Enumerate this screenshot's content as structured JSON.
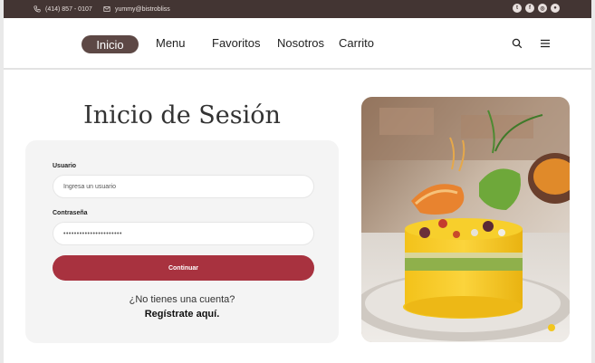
{
  "topbar": {
    "phone": "(414) 857 - 0107",
    "email": "yummy@bistrobliss",
    "social_icons": [
      "twitter-icon",
      "facebook-icon",
      "instagram-icon",
      "github-icon"
    ],
    "social_glyphs": [
      "t",
      "f",
      "◎",
      "●"
    ],
    "background": "#433533"
  },
  "nav": {
    "items": [
      "Inicio",
      "Menu",
      "Favoritos",
      "Nosotros",
      "Carrito"
    ],
    "active_index": 0,
    "active_color": "#5d4845"
  },
  "login": {
    "title": "Inicio de Sesión",
    "user_label": "Usuario",
    "user_placeholder": "Ingresa un usuario",
    "password_label": "Contraseña",
    "password_value": "••••••••••••••••••••••",
    "submit_label": "Continuar",
    "no_account_text": "¿No tienes una cuenta?",
    "register_link": "Regístrate aquí.",
    "accent_color": "#a8323f"
  },
  "image": {
    "subject": "causa-limena-dish-photo"
  }
}
